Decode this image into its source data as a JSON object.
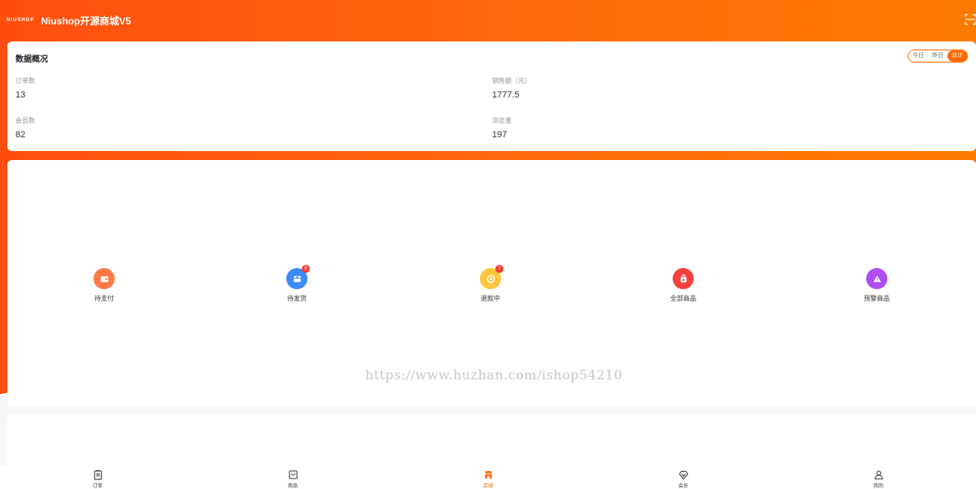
{
  "header": {
    "logo_text": "NIUSHOP",
    "shop_name": "Niushop开源商城V5"
  },
  "overview": {
    "title": "数据概况",
    "range_tabs": [
      "今日",
      "昨日",
      "总计"
    ],
    "active_range": "总计",
    "stats": [
      {
        "label": "订单数",
        "value": "13"
      },
      {
        "label": "销售额（元）",
        "value": "1777.5"
      },
      {
        "label": "会员数",
        "value": "82"
      },
      {
        "label": "浏览量",
        "value": "197"
      }
    ]
  },
  "shortcuts": [
    {
      "label": "待支付",
      "icon": "wallet-icon",
      "color": "#ff7a45",
      "badge": ""
    },
    {
      "label": "待发货",
      "icon": "box-icon",
      "color": "#3d8bfd",
      "badge": "6"
    },
    {
      "label": "退款中",
      "icon": "refund-icon",
      "color": "#ffc53d",
      "badge": "2"
    },
    {
      "label": "全部商品",
      "icon": "shopping-bag-icon",
      "color": "#f5403d",
      "badge": ""
    },
    {
      "label": "预警商品",
      "icon": "warning-icon",
      "color": "#b04ef5",
      "badge": ""
    }
  ],
  "watermark": "https://www.huzhan.com/ishop54210",
  "tabbar": [
    {
      "label": "订单",
      "icon": "order-icon"
    },
    {
      "label": "商品",
      "icon": "goods-icon"
    },
    {
      "label": "店铺",
      "icon": "store-icon"
    },
    {
      "label": "会员",
      "icon": "member-icon"
    },
    {
      "label": "我的",
      "icon": "user-icon"
    }
  ],
  "active_tab": "店铺",
  "colors": {
    "brand": "#ff6a00",
    "gradient_start": "#ff4e0f",
    "gradient_end": "#ff7b00"
  }
}
